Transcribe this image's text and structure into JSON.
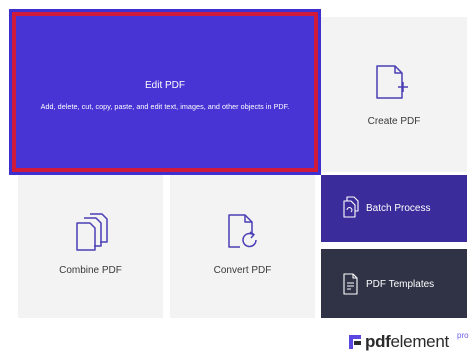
{
  "edit_tile": {
    "title": "Edit PDF",
    "description": "Add, delete, cut, copy, paste, and edit text, images, and other objects in PDF."
  },
  "create_tile": {
    "label": "Create PDF",
    "icon": "create-pdf-icon"
  },
  "combine_tile": {
    "label": "Combine PDF",
    "icon": "combine-pdf-icon"
  },
  "convert_tile": {
    "label": "Convert PDF",
    "icon": "convert-pdf-icon"
  },
  "batch_tile": {
    "label": "Batch Process",
    "icon": "batch-process-icon"
  },
  "templates_tile": {
    "label": "PDF Templates",
    "icon": "pdf-templates-icon"
  },
  "logo": {
    "name_bold": "pdf",
    "name_rest": "element",
    "badge": "pro"
  },
  "colors": {
    "edit_tile_bg": "#4834d4",
    "highlight_border": "#d01a3c",
    "batch_bg": "#3a2d9b",
    "templates_bg": "#2f3345",
    "icon_stroke": "#4a3fb5"
  }
}
